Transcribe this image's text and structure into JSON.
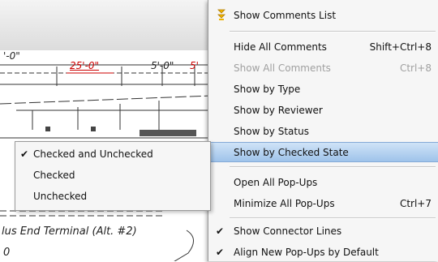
{
  "drawing": {
    "dim_left": "'-0\"",
    "dim_mid": "25'-0\"",
    "dim_right_a": "5'-0\"",
    "dim_right_b": "5'",
    "terminal_note": "lus End Terminal (Alt. #2)",
    "bottom_fragment": "0"
  },
  "context_menu": {
    "items": [
      {
        "label": "Show Comments List",
        "shortcut": "",
        "icon": "comments-list-icon",
        "checked": false,
        "disabled": false,
        "highlighted": false
      },
      {
        "label": "Hide All Comments",
        "shortcut": "Shift+Ctrl+8",
        "checked": false,
        "disabled": false,
        "highlighted": false
      },
      {
        "label": "Show All Comments",
        "shortcut": "Ctrl+8",
        "checked": false,
        "disabled": true,
        "highlighted": false
      },
      {
        "label": "Show by Type",
        "shortcut": "",
        "checked": false,
        "disabled": false,
        "highlighted": false
      },
      {
        "label": "Show by Reviewer",
        "shortcut": "",
        "checked": false,
        "disabled": false,
        "highlighted": false
      },
      {
        "label": "Show by Status",
        "shortcut": "",
        "checked": false,
        "disabled": false,
        "highlighted": false
      },
      {
        "label": "Show by Checked State",
        "shortcut": "",
        "checked": false,
        "disabled": false,
        "highlighted": true
      },
      {
        "label": "Open All Pop-Ups",
        "shortcut": "",
        "checked": false,
        "disabled": false,
        "highlighted": false
      },
      {
        "label": "Minimize All Pop-Ups",
        "shortcut": "Ctrl+7",
        "checked": false,
        "disabled": false,
        "highlighted": false
      },
      {
        "label": "Show Connector Lines",
        "shortcut": "",
        "checked": true,
        "disabled": false,
        "highlighted": false
      },
      {
        "label": "Align New Pop-Ups by Default",
        "shortcut": "",
        "checked": true,
        "disabled": false,
        "highlighted": false
      }
    ],
    "check_glyph": "✔"
  },
  "submenu": {
    "items": [
      {
        "label": "Checked and Unchecked",
        "checked": true
      },
      {
        "label": "Checked",
        "checked": false
      },
      {
        "label": "Unchecked",
        "checked": false
      }
    ]
  },
  "colors": {
    "highlight": "#9fc3ea",
    "menu_bg": "#f6f6f6",
    "disabled_text": "#a0a0a0",
    "dimension_red": "#cc0000"
  }
}
